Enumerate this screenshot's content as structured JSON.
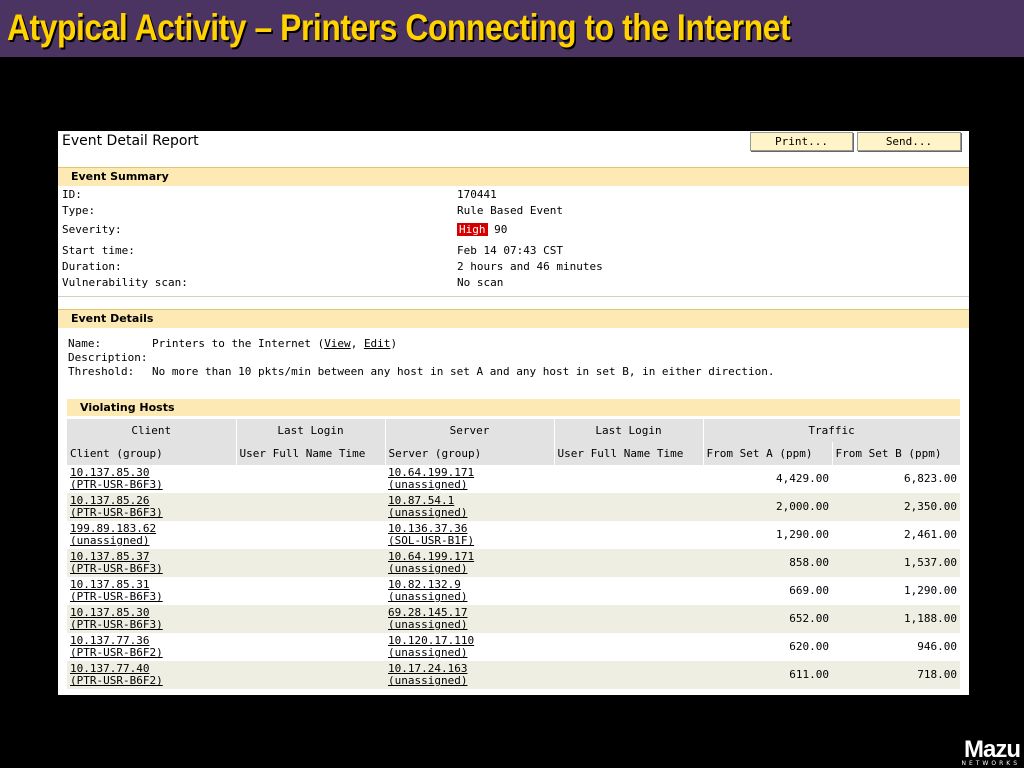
{
  "slide": {
    "title": "Atypical Activity – Printers Connecting to the Internet",
    "logo_text": "Mazu",
    "logo_sub": "NETWORKS",
    "colors": {
      "title_bg": "#4b3461",
      "title_text": "#ffd200",
      "section_bg": "#fce9b4",
      "severity_high": "#d40000"
    }
  },
  "report": {
    "title": "Event Detail Report",
    "print_label": "Print...",
    "send_label": "Send..."
  },
  "summary": {
    "heading": "Event Summary",
    "rows": [
      {
        "key": "ID:",
        "value": "170441"
      },
      {
        "key": "Type:",
        "value": "Rule Based Event"
      },
      {
        "key": "Severity:",
        "badge": "High",
        "value": "90"
      },
      {
        "key": "Start time:",
        "value": "Feb 14 07:43 CST"
      },
      {
        "key": "Duration:",
        "value": "2 hours and 46 minutes"
      },
      {
        "key": "Vulnerability scan:",
        "value": "No scan"
      }
    ]
  },
  "details": {
    "heading": "Event Details",
    "name_key": "Name:",
    "name_value": "Printers to the Internet (",
    "view_link": "View",
    "comma": ", ",
    "edit_link": "Edit",
    "close_paren": ")",
    "description_key": "Description:",
    "threshold_key": "Threshold:",
    "threshold_value": "No more than 10 pkts/min between any host in set A and any host in set B, in either direction."
  },
  "violating_hosts": {
    "heading": "Violating Hosts",
    "group_headers": [
      "Client",
      "Last Login",
      "Server",
      "Last Login",
      "Traffic"
    ],
    "columns": [
      "Client (group)",
      "User Full Name Time",
      "Server (group)",
      "User Full Name Time",
      "From Set A (ppm)",
      "From Set B (ppm)"
    ],
    "rows": [
      {
        "client_ip": "10.137.85.30",
        "client_group": "(PTR-USR-B6F3)",
        "server_ip": "10.64.199.171",
        "server_group": "(unassigned)",
        "from_a": "4,429.00",
        "from_b": "6,823.00"
      },
      {
        "client_ip": "10.137.85.26",
        "client_group": "(PTR-USR-B6F3)",
        "server_ip": "10.87.54.1",
        "server_group": "(unassigned)",
        "from_a": "2,000.00",
        "from_b": "2,350.00"
      },
      {
        "client_ip": "199.89.183.62",
        "client_group": "(unassigned)",
        "server_ip": "10.136.37.36",
        "server_group": "(SOL-USR-B1F)",
        "from_a": "1,290.00",
        "from_b": "2,461.00"
      },
      {
        "client_ip": "10.137.85.37",
        "client_group": "(PTR-USR-B6F3)",
        "server_ip": "10.64.199.171",
        "server_group": "(unassigned)",
        "from_a": "858.00",
        "from_b": "1,537.00"
      },
      {
        "client_ip": "10.137.85.31",
        "client_group": "(PTR-USR-B6F3)",
        "server_ip": "10.82.132.9",
        "server_group": "(unassigned)",
        "from_a": "669.00",
        "from_b": "1,290.00"
      },
      {
        "client_ip": "10.137.85.30",
        "client_group": "(PTR-USR-B6F3)",
        "server_ip": "69.28.145.17",
        "server_group": "(unassigned)",
        "from_a": "652.00",
        "from_b": "1,188.00"
      },
      {
        "client_ip": "10.137.77.36",
        "client_group": "(PTR-USR-B6F2)",
        "server_ip": "10.120.17.110",
        "server_group": "(unassigned)",
        "from_a": "620.00",
        "from_b": "946.00"
      },
      {
        "client_ip": "10.137.77.40",
        "client_group": "(PTR-USR-B6F2)",
        "server_ip": "10.17.24.163",
        "server_group": "(unassigned)",
        "from_a": "611.00",
        "from_b": "718.00"
      }
    ]
  }
}
